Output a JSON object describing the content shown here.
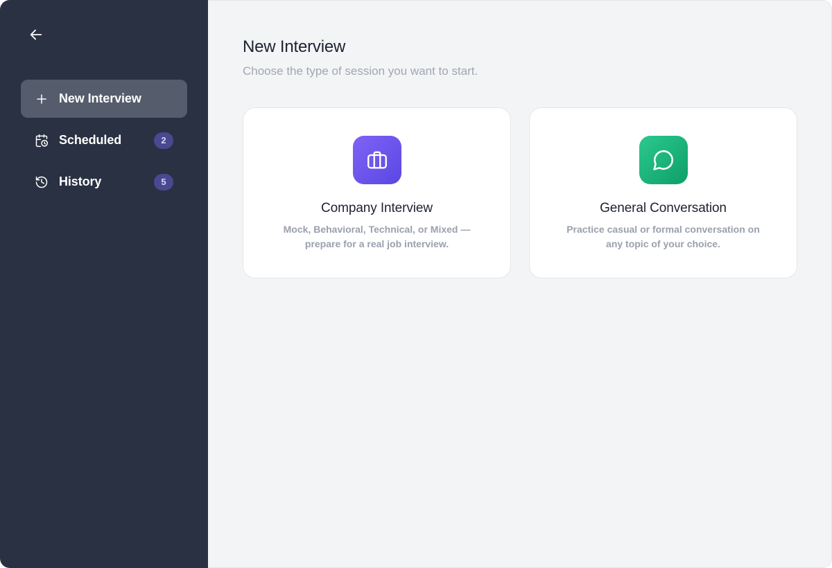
{
  "sidebar": {
    "back_icon": "arrow-left-icon",
    "items": [
      {
        "label": "New Interview",
        "icon": "plus-icon",
        "active": true
      },
      {
        "label": "Scheduled",
        "icon": "calendar-clock-icon",
        "badge": "2"
      },
      {
        "label": "History",
        "icon": "history-icon",
        "badge": "5"
      }
    ]
  },
  "main": {
    "title": "New Interview",
    "subtitle": "Choose the type of session you want to start.",
    "cards": [
      {
        "title": "Company Interview",
        "description": "Mock, Behavioral, Technical, or Mixed — prepare for a real job interview.",
        "icon": "briefcase-icon",
        "color": "#6b52ee"
      },
      {
        "title": "General Conversation",
        "description": "Practice casual or formal conversation on any topic of your choice.",
        "icon": "chat-bubble-icon",
        "color": "#18b37a"
      }
    ]
  },
  "colors": {
    "sidebar_bg": "#2a3142",
    "active_item_bg": "#555c6c",
    "badge_bg": "#4a4891",
    "main_bg": "#f3f4f6"
  }
}
